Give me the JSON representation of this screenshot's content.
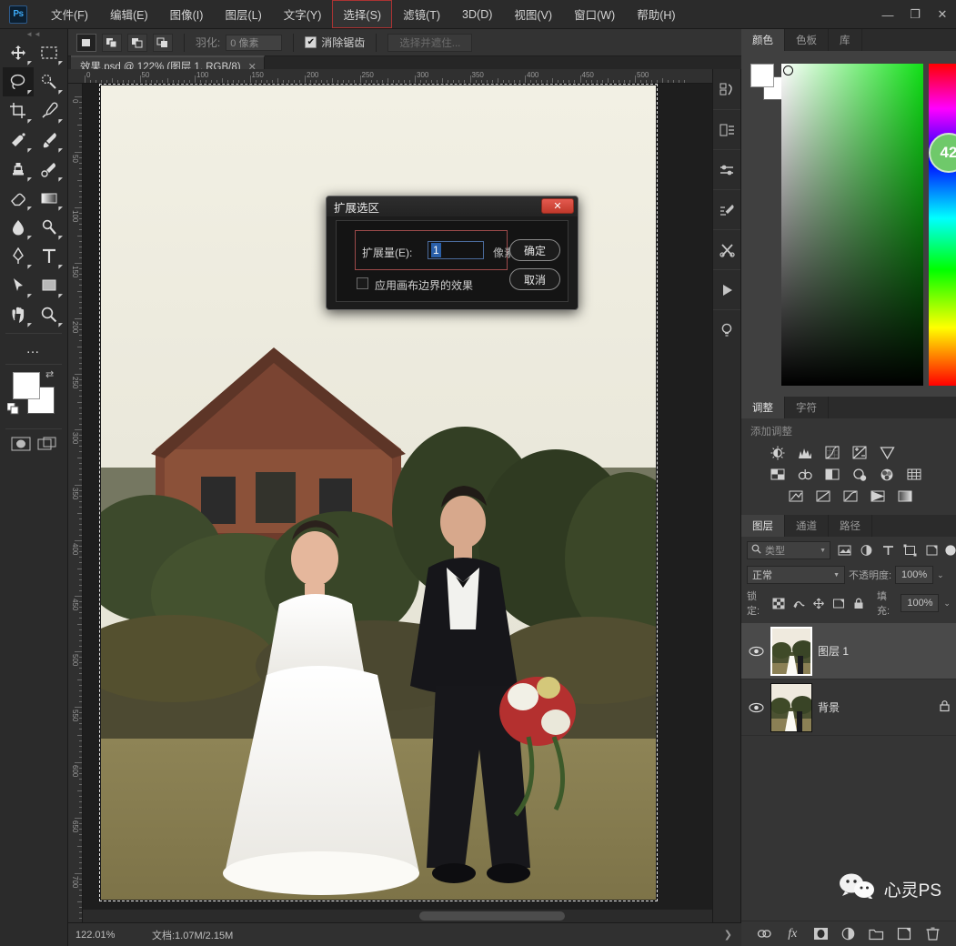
{
  "app": {
    "logo": "Ps",
    "window_controls": {
      "minimize": "—",
      "maximize": "❐",
      "close": "✕"
    }
  },
  "menubar": {
    "items": [
      {
        "label": "文件(F)",
        "name": "menu-file"
      },
      {
        "label": "编辑(E)",
        "name": "menu-edit"
      },
      {
        "label": "图像(I)",
        "name": "menu-image"
      },
      {
        "label": "图层(L)",
        "name": "menu-layer"
      },
      {
        "label": "文字(Y)",
        "name": "menu-type"
      },
      {
        "label": "选择(S)",
        "name": "menu-select",
        "highlight": true
      },
      {
        "label": "滤镜(T)",
        "name": "menu-filter"
      },
      {
        "label": "3D(D)",
        "name": "menu-3d"
      },
      {
        "label": "视图(V)",
        "name": "menu-view"
      },
      {
        "label": "窗口(W)",
        "name": "menu-window"
      },
      {
        "label": "帮助(H)",
        "name": "menu-help"
      }
    ]
  },
  "options_bar": {
    "tool_icon": "lasso-icon",
    "feather_label": "羽化:",
    "feather_value": "0 像素",
    "antialias_label": "消除锯齿",
    "antialias_checked": true,
    "refine_button": "选择并遮住..."
  },
  "document_tab": {
    "title": "效果.psd @ 122% (图层 1, RGB/8)",
    "close": "✕"
  },
  "toolbar": {
    "tools": [
      {
        "name": "move-tool",
        "glyph": "move"
      },
      {
        "name": "marquee-tool",
        "glyph": "marquee"
      },
      {
        "name": "lasso-tool",
        "glyph": "lasso",
        "selected": true
      },
      {
        "name": "quick-select-tool",
        "glyph": "quickselect"
      },
      {
        "name": "crop-tool",
        "glyph": "crop"
      },
      {
        "name": "eyedropper-tool",
        "glyph": "eyedropper"
      },
      {
        "name": "healing-brush-tool",
        "glyph": "healing"
      },
      {
        "name": "brush-tool",
        "glyph": "brush"
      },
      {
        "name": "clone-stamp-tool",
        "glyph": "stamp"
      },
      {
        "name": "history-brush-tool",
        "glyph": "historybrush"
      },
      {
        "name": "eraser-tool",
        "glyph": "eraser"
      },
      {
        "name": "gradient-tool",
        "glyph": "gradient"
      },
      {
        "name": "blur-tool",
        "glyph": "blur"
      },
      {
        "name": "dodge-tool",
        "glyph": "dodge"
      },
      {
        "name": "pen-tool",
        "glyph": "pen"
      },
      {
        "name": "type-tool",
        "glyph": "type"
      },
      {
        "name": "path-select-tool",
        "glyph": "pathselect"
      },
      {
        "name": "shape-tool",
        "glyph": "shape"
      },
      {
        "name": "hand-tool",
        "glyph": "hand"
      },
      {
        "name": "zoom-tool",
        "glyph": "zoom"
      }
    ],
    "more_tools": "…",
    "swap_colors": "⇄",
    "foreground_color": "#ffffff",
    "background_color": "#ffffff"
  },
  "rulers": {
    "horizontal_ticks": [
      "0",
      "50",
      "100",
      "150",
      "200",
      "250",
      "300",
      "350",
      "400",
      "450",
      "500"
    ],
    "vertical_ticks": [
      "0",
      "50",
      "100",
      "150",
      "200",
      "250",
      "300",
      "350",
      "400",
      "450",
      "500",
      "550",
      "600",
      "650",
      "700"
    ]
  },
  "status_bar": {
    "zoom": "122.01%",
    "doc_info": "文档:1.07M/2.15M",
    "arrow": "❯"
  },
  "dialog": {
    "title": "扩展选区",
    "close_glyph": "✕",
    "field_label": "扩展量(E):",
    "field_value": "1",
    "unit": "像素",
    "checkbox_label": "应用画布边界的效果",
    "checkbox_checked": false,
    "ok_button": "确定",
    "cancel_button": "取消"
  },
  "icon_dock": {
    "items": [
      {
        "name": "history-panel-icon"
      },
      {
        "name": "properties-panel-icon"
      },
      {
        "name": "adjustments-panel-icon"
      },
      {
        "name": "brush-settings-icon"
      },
      {
        "name": "tool-presets-icon"
      },
      {
        "name": "actions-panel-icon"
      },
      {
        "name": "learn-panel-icon"
      }
    ]
  },
  "color_panel": {
    "tabs": [
      {
        "label": "颜色",
        "active": true
      },
      {
        "label": "色板",
        "active": false
      },
      {
        "label": "库",
        "active": false
      }
    ],
    "badge": "42"
  },
  "adjustments_panel": {
    "tabs": [
      {
        "label": "调整",
        "active": true
      },
      {
        "label": "字符",
        "active": false
      }
    ],
    "title": "添加调整",
    "row1": [
      "brightness-contrast-icon",
      "levels-icon",
      "curves-icon",
      "exposure-icon",
      "vibrance-icon"
    ],
    "row2": [
      "hue-saturation-icon",
      "color-balance-icon",
      "black-white-icon",
      "photo-filter-icon",
      "channel-mixer-icon",
      "color-lookup-icon"
    ],
    "row3": [
      "invert-icon",
      "posterize-icon",
      "threshold-icon",
      "gradient-map-icon",
      "selective-color-icon"
    ]
  },
  "layers_panel": {
    "tabs": [
      {
        "label": "图层",
        "active": true
      },
      {
        "label": "通道",
        "active": false
      },
      {
        "label": "路径",
        "active": false
      }
    ],
    "filter_placeholder": "类型",
    "filter_icons": [
      "pixel-filter-icon",
      "adjustment-filter-icon",
      "type-filter-icon",
      "shape-filter-icon",
      "smart-filter-icon"
    ],
    "blend_mode": "正常",
    "opacity_label": "不透明度:",
    "opacity_value": "100%",
    "lock_label": "锁定:",
    "fill_label": "填充:",
    "fill_value": "100%",
    "lock_icons": [
      "lock-transparent-icon",
      "lock-image-icon",
      "lock-position-icon",
      "lock-artboard-icon",
      "lock-all-icon"
    ],
    "layers": [
      {
        "name": "图层 1",
        "visible": true,
        "selected": true,
        "locked": false
      },
      {
        "name": "背景",
        "visible": true,
        "selected": false,
        "locked": true
      }
    ],
    "bottom_buttons": [
      "link-layers-icon",
      "layer-style-icon",
      "add-mask-icon",
      "new-adjustment-icon",
      "new-group-icon",
      "new-layer-icon",
      "delete-layer-icon"
    ]
  },
  "watermark": {
    "text": "心灵PS",
    "icon": "wechat-icon"
  },
  "colors": {
    "accent_red": "#c0392b",
    "panel_bg": "#353535",
    "toolbar_bg": "#2b2b2b",
    "selection_blue": "#2a5fa8"
  }
}
